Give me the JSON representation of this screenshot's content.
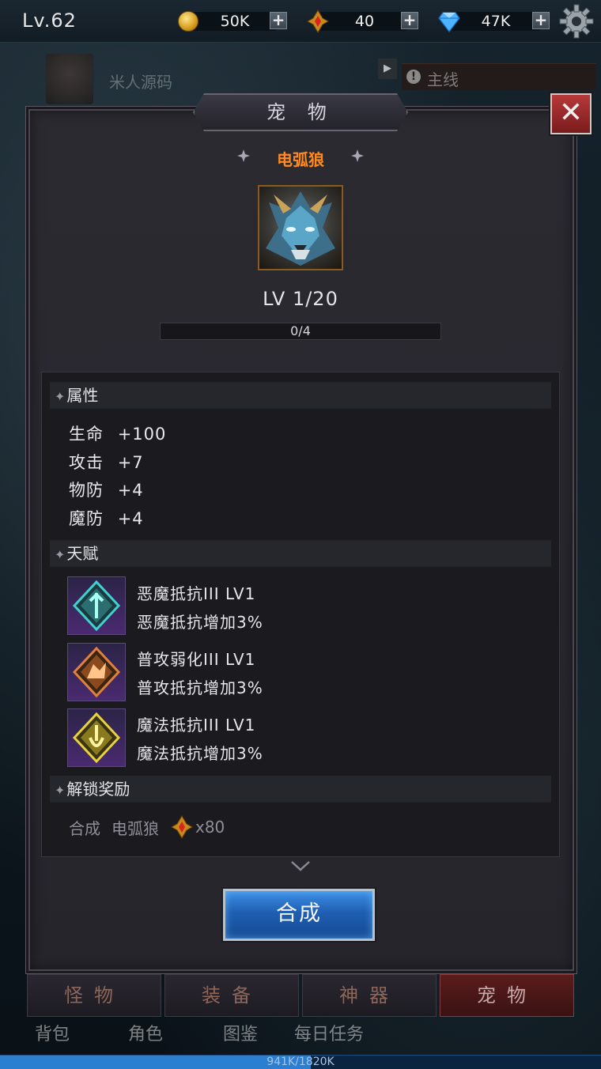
{
  "topbar": {
    "level": "Lv.62",
    "gold": "50K",
    "energy": "40",
    "diamond": "47K"
  },
  "hud": {
    "player_name": "米人源码",
    "quest_label": "主线"
  },
  "panel": {
    "title": "宠 物",
    "pet_name": "电弧狼",
    "pet_level": "LV 1/20",
    "progress_text": "0/4",
    "progress_fraction": 0.0
  },
  "sections": {
    "attributes": "属性",
    "talents": "天赋",
    "unlock": "解锁奖励"
  },
  "attributes": [
    {
      "name": "生命",
      "value": "+100"
    },
    {
      "name": "攻击",
      "value": "+7"
    },
    {
      "name": "物防",
      "value": "+4"
    },
    {
      "name": "魔防",
      "value": "+4"
    }
  ],
  "talents": [
    {
      "title": "恶魔抵抗III LV1",
      "desc": "恶魔抵抗增加3%",
      "icon": "demon-resist-icon",
      "color": "#3fd0d0"
    },
    {
      "title": "普攻弱化III LV1",
      "desc": "普攻抵抗增加3%",
      "icon": "attack-weaken-icon",
      "color": "#e0803a"
    },
    {
      "title": "魔法抵抗III LV1",
      "desc": "魔法抵抗增加3%",
      "icon": "magic-resist-icon",
      "color": "#e6d23a"
    }
  ],
  "unlock": {
    "action": "合成",
    "target": "电弧狼",
    "cost": "x80"
  },
  "compose_button": "合成",
  "tabs": [
    {
      "label": "怪物",
      "active": false
    },
    {
      "label": "装备",
      "active": false
    },
    {
      "label": "神器",
      "active": false
    },
    {
      "label": "宠物",
      "active": true
    }
  ],
  "bottom_nav": [
    "背包",
    "角色",
    "图鉴",
    "每日任务"
  ],
  "xp": {
    "text": "941K/1820K",
    "fraction": 0.517
  }
}
